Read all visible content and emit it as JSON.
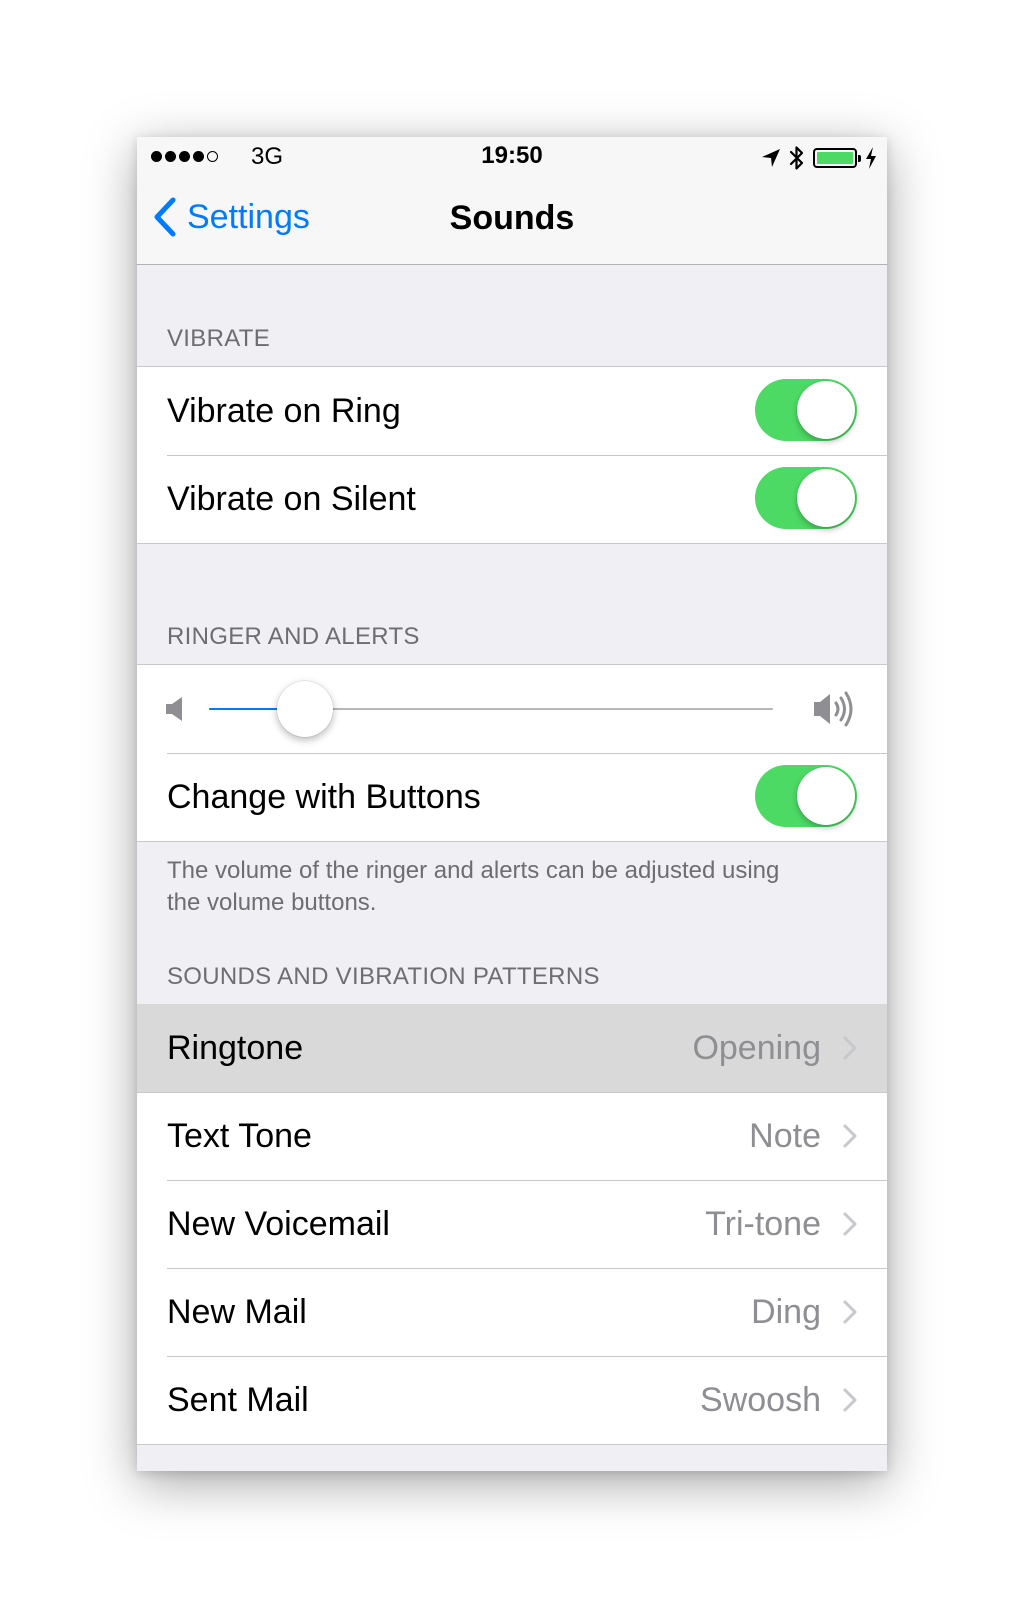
{
  "status_bar": {
    "carrier": "3G",
    "time": "19:50",
    "signal_bars_filled": 4,
    "signal_bars_total": 5,
    "icons": [
      "location-arrow-icon",
      "bluetooth-icon",
      "battery-icon",
      "charging-bolt-icon"
    ]
  },
  "nav": {
    "back_label": "Settings",
    "title": "Sounds"
  },
  "vibrate": {
    "header": "VIBRATE",
    "rows": [
      {
        "label": "Vibrate on Ring",
        "on": true
      },
      {
        "label": "Vibrate on Silent",
        "on": true
      }
    ]
  },
  "ringer": {
    "header": "RINGER AND ALERTS",
    "volume_fraction": 0.17,
    "change_with_buttons_label": "Change with Buttons",
    "change_with_buttons_on": true,
    "footer": "The volume of the ringer and alerts can be adjusted using the volume buttons."
  },
  "sounds": {
    "header": "SOUNDS AND VIBRATION PATTERNS",
    "rows": [
      {
        "label": "Ringtone",
        "value": "Opening",
        "highlighted": true
      },
      {
        "label": "Text Tone",
        "value": "Note"
      },
      {
        "label": "New Voicemail",
        "value": "Tri-tone"
      },
      {
        "label": "New Mail",
        "value": "Ding"
      },
      {
        "label": "Sent Mail",
        "value": "Swoosh"
      }
    ]
  },
  "colors": {
    "accent": "#007aff",
    "toggle_on": "#4cd964",
    "background": "#efeff4"
  }
}
